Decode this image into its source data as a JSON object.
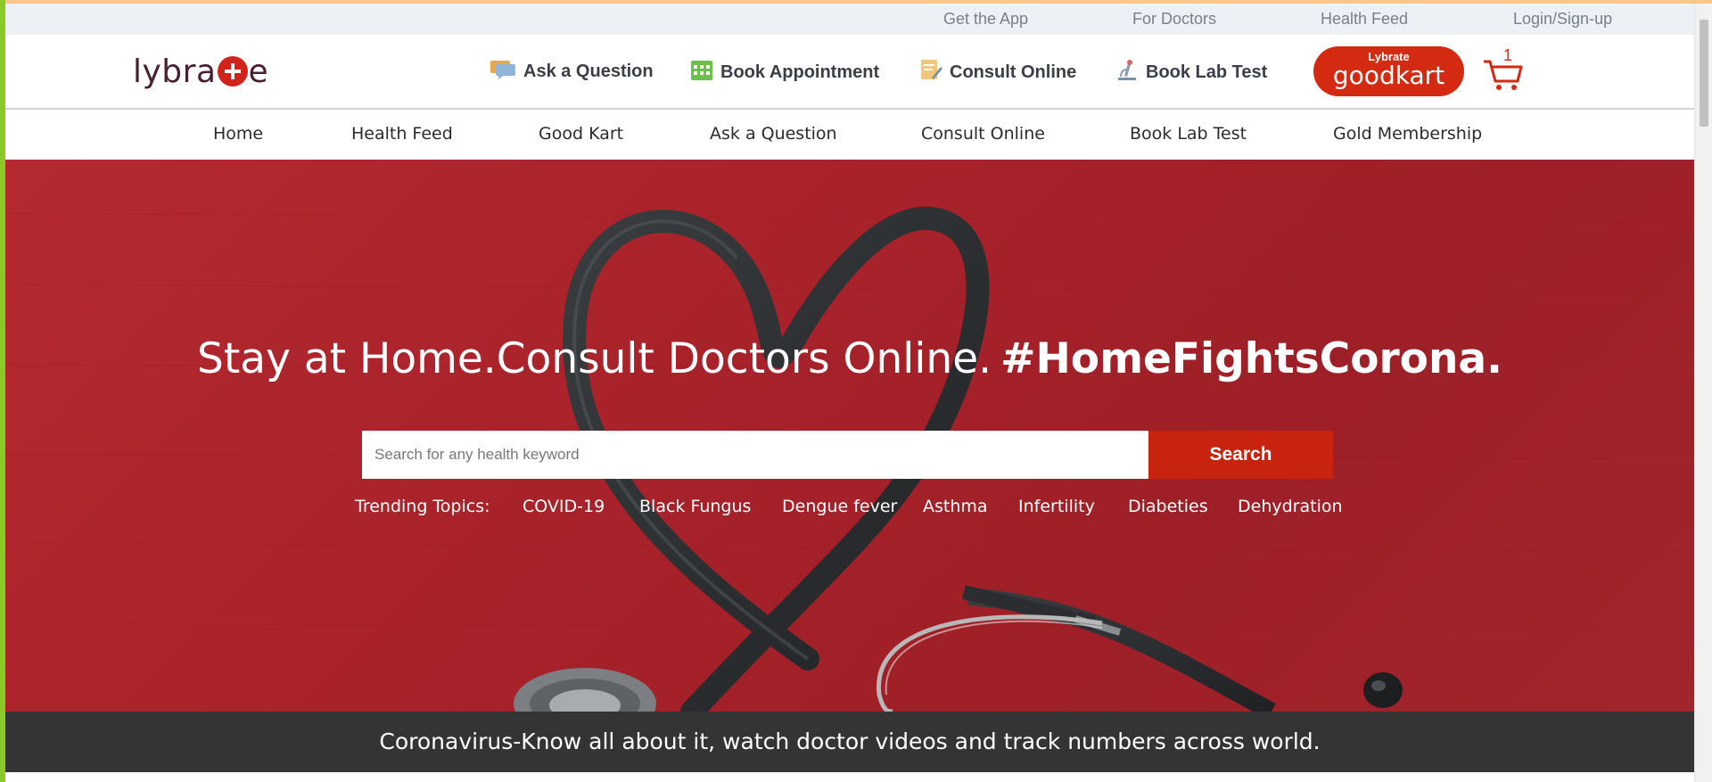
{
  "util_bar": {
    "links": [
      "Get the App",
      "For Doctors",
      "Health Feed",
      "Login/Sign-up"
    ]
  },
  "header": {
    "logo_text_left": "lybra",
    "logo_text_right": "e",
    "nav": [
      {
        "label": "Ask a Question",
        "icon": "chat-icon"
      },
      {
        "label": "Book Appointment",
        "icon": "calendar-icon"
      },
      {
        "label": "Consult Online",
        "icon": "consult-icon"
      },
      {
        "label": "Book Lab Test",
        "icon": "microscope-icon"
      }
    ],
    "goodkart": {
      "small": "Lybrate",
      "big": "goodkart"
    },
    "cart_count": "1"
  },
  "main_nav": [
    "Home",
    "Health Feed",
    "Good Kart",
    "Ask a Question",
    "Consult Online",
    "Book Lab Test",
    "Gold Membership"
  ],
  "hero": {
    "headline": "Stay at Home.Consult Doctors Online.",
    "headline_bold": "#HomeFightsCorona.",
    "search_placeholder": "Search for any health keyword",
    "search_button": "Search",
    "trending_label": "Trending Topics:",
    "trending": [
      "COVID-19",
      "Black Fungus",
      "Dengue fever",
      "Asthma",
      "Infertility",
      "Diabeties",
      "Dehydration"
    ]
  },
  "banner": {
    "text": "Coronavirus-Know all about it, watch doctor videos and track numbers across world."
  },
  "colors": {
    "brand_red": "#d42a12",
    "hero_red": "#a8222a",
    "banner_dark": "#343434",
    "logo_maroon": "#4a1f33"
  }
}
